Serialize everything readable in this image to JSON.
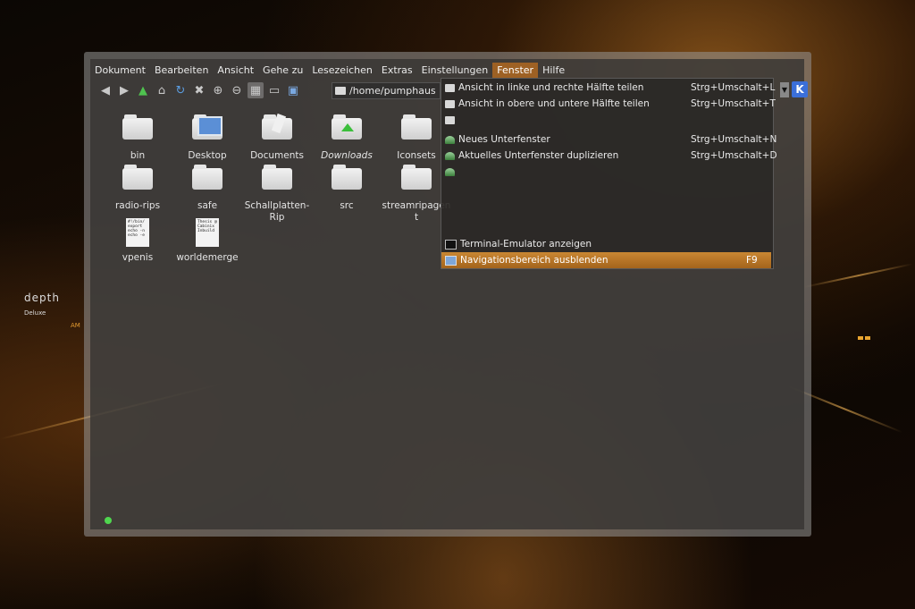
{
  "wallpaper": {
    "logo_text": "depth",
    "logo_sub": "Deluxe",
    "logo_small": "AM"
  },
  "menubar": {
    "items": [
      "Dokument",
      "Bearbeiten",
      "Ansicht",
      "Gehe zu",
      "Lesezeichen",
      "Extras",
      "Einstellungen",
      "Fenster",
      "Hilfe"
    ],
    "active": "Fenster"
  },
  "toolbar": {
    "location": "/home/pumphaus",
    "icons": [
      "back-icon",
      "forward-icon",
      "up-icon",
      "home-icon",
      "reload-icon",
      "stop-icon",
      "zoom-in-icon",
      "zoom-out-icon",
      "icon-view-icon",
      "detail-view-icon",
      "preview-icon"
    ]
  },
  "files": [
    {
      "name": "bin",
      "kind": "folder"
    },
    {
      "name": "Desktop",
      "kind": "desktop"
    },
    {
      "name": "Documents",
      "kind": "documents"
    },
    {
      "name": "Downloads",
      "kind": "downloads",
      "italic": true
    },
    {
      "name": "Iconsets",
      "kind": "folder"
    },
    {
      "name": "radio-rips",
      "kind": "folder"
    },
    {
      "name": "safe",
      "kind": "folder"
    },
    {
      "name": "Schallplatten-Rip",
      "kind": "folder"
    },
    {
      "name": "src",
      "kind": "folder"
    },
    {
      "name": "streamripagent",
      "kind": "folder"
    },
    {
      "name": "vpenis",
      "kind": "text",
      "preview": "#!/bin/\nexport\necho -n\necho -e"
    },
    {
      "name": "worldemerge",
      "kind": "text",
      "preview": "Thesis @\nCabinix\nInbuild"
    }
  ],
  "dropdown": {
    "items": [
      {
        "label": "Ansicht in linke und rechte Hälfte teilen",
        "shortcut": "Strg+Umschalt+L",
        "icon": "split-view-icon"
      },
      {
        "label": "Ansicht in obere und untere Hälfte teilen",
        "shortcut": "Strg+Umschalt+T",
        "icon": "split-view-icon"
      },
      {
        "label": "",
        "shortcut": "",
        "icon": "window-icon"
      },
      {
        "label": "Neues Unterfenster",
        "shortcut": "Strg+Umschalt+N",
        "icon": "new-tab-icon"
      },
      {
        "label": "Aktuelles Unterfenster duplizieren",
        "shortcut": "Strg+Umschalt+D",
        "icon": "duplicate-tab-icon"
      },
      {
        "label": "",
        "shortcut": "",
        "icon": "tab-icon"
      },
      {
        "label": "Terminal-Emulator anzeigen",
        "shortcut": "",
        "icon": "terminal-icon"
      },
      {
        "label": "Navigationsbereich ausblenden",
        "shortcut": "F9",
        "icon": "navigation-panel-icon"
      }
    ]
  },
  "colors": {
    "accent": "#c98733",
    "status_led": "#4fd64f"
  }
}
